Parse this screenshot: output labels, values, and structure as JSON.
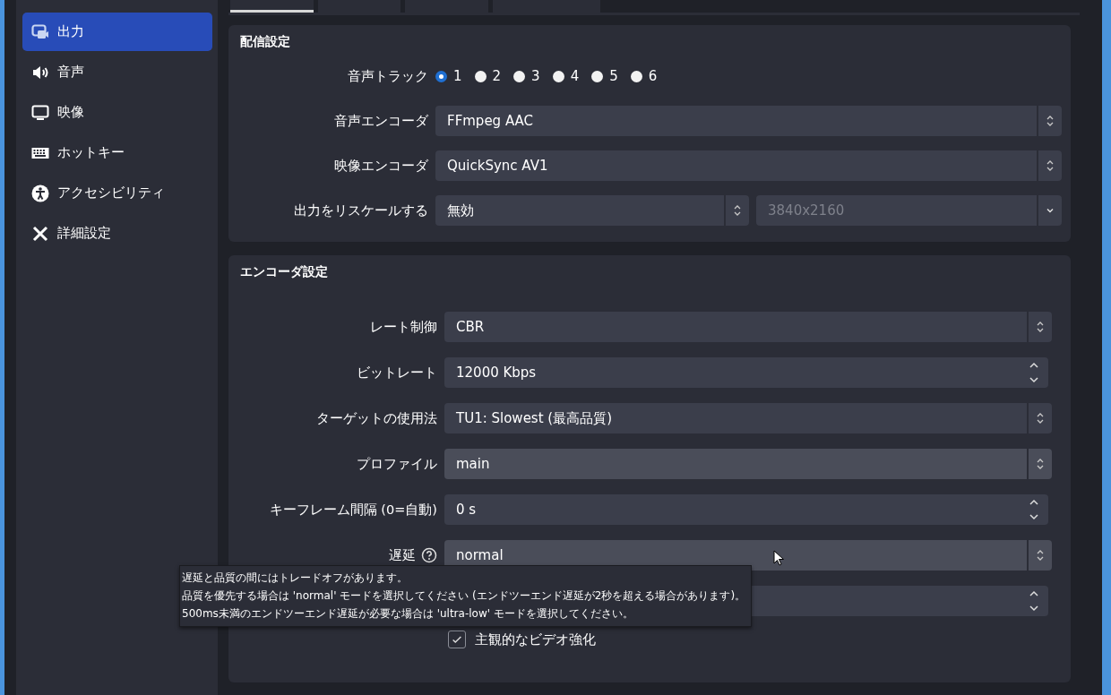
{
  "sidebar": {
    "items": [
      {
        "label": "出力",
        "selected": true
      },
      {
        "label": "音声",
        "selected": false
      },
      {
        "label": "映像",
        "selected": false
      },
      {
        "label": "ホットキー",
        "selected": false
      },
      {
        "label": "アクセシビリティ",
        "selected": false
      },
      {
        "label": "詳細設定",
        "selected": false
      }
    ]
  },
  "tabs": [
    {
      "selected": true
    },
    {
      "selected": false
    },
    {
      "selected": false
    },
    {
      "selected": false
    }
  ],
  "streaming": {
    "title": "配信設定",
    "audio_track": {
      "label": "音声トラック",
      "options": [
        {
          "label": "1",
          "selected": true
        },
        {
          "label": "2",
          "selected": false
        },
        {
          "label": "3",
          "selected": false
        },
        {
          "label": "4",
          "selected": false
        },
        {
          "label": "5",
          "selected": false
        },
        {
          "label": "6",
          "selected": false
        }
      ]
    },
    "rows": [
      {
        "label": "音声エンコーダ",
        "fields": [
          {
            "kind": "combo",
            "value": "FFmpeg AAC",
            "disabled": false
          }
        ]
      },
      {
        "label": "映像エンコーダ",
        "fields": [
          {
            "kind": "combo",
            "value": "QuickSync AV1",
            "disabled": false
          }
        ]
      },
      {
        "label": "出力をリスケールする",
        "fields": [
          {
            "kind": "combo",
            "value": "無効",
            "disabled": false
          },
          {
            "kind": "dropdown",
            "value": "3840x2160",
            "disabled": true
          }
        ]
      }
    ]
  },
  "encoder": {
    "title": "エンコーダ設定",
    "rows": [
      {
        "kind": "combo",
        "label": "レート制御",
        "value": "CBR",
        "help": false
      },
      {
        "kind": "spin",
        "label": "ビットレート",
        "value": "12000 Kbps",
        "help": false
      },
      {
        "kind": "combo",
        "label": "ターゲットの使用法",
        "value": "TU1: Slowest (最高品質)",
        "help": false
      },
      {
        "kind": "combo",
        "label": "プロファイル",
        "value": "main",
        "help": false
      },
      {
        "kind": "spin",
        "label": "キーフレーム間隔 (0=自動)",
        "value": "0 s",
        "help": false
      },
      {
        "kind": "combo",
        "label": "遅延",
        "value": "normal",
        "help": true
      },
      {
        "kind": "spin"
      },
      {
        "kind": "checkbox",
        "label": "主観的なビデオ強化",
        "checked": true
      }
    ],
    "tooltip": [
      "遅延と品質の間にはトレードオフがあります。",
      "品質を優先する場合は 'normal' モードを選択してください (エンドツーエンド遅延が2秒を超える場合があります)。",
      "500ms未満のエンドツーエンド遅延が必要な場合は 'ultra-low' モードを選択してください。"
    ]
  }
}
